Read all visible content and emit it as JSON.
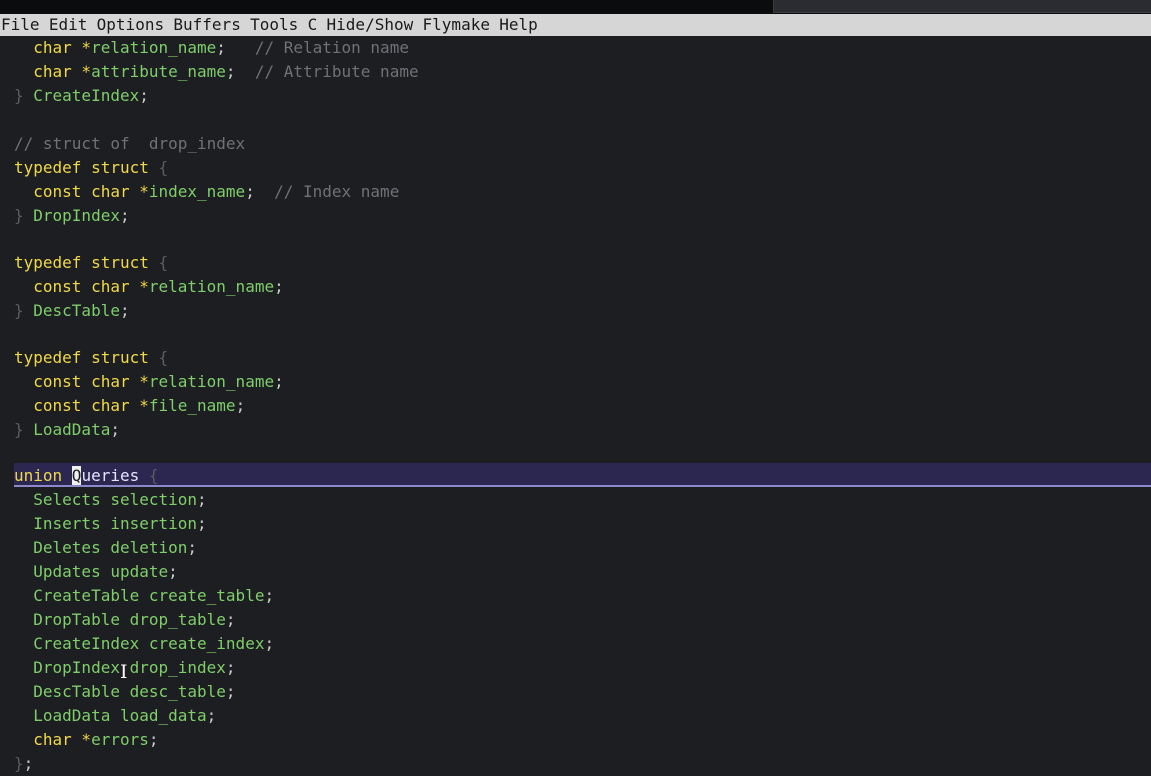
{
  "menubar": {
    "items": [
      "File",
      "Edit",
      "Options",
      "Buffers",
      "Tools",
      "C",
      "Hide/Show",
      "Flymake",
      "Help"
    ]
  },
  "editor": {
    "lines": [
      {
        "t1": "  char *",
        "t2": "relation_name",
        "t3": ";   ",
        "t4": "// Relation name"
      },
      {
        "t1": "  char *",
        "t2": "attribute_name",
        "t3": ";  ",
        "t4": "// Attribute name"
      },
      {
        "t1": "} ",
        "t2": "CreateIndex",
        "t3": ";"
      },
      {
        "t1": ""
      },
      {
        "t1": "// struct of  drop_index"
      },
      {
        "t1": "typedef struct ",
        "t2": "{"
      },
      {
        "t1": "  const char *",
        "t2": "index_name",
        "t3": ";  ",
        "t4": "// Index name"
      },
      {
        "t1": "} ",
        "t2": "DropIndex",
        "t3": ";"
      },
      {
        "t1": ""
      },
      {
        "t1": "typedef struct ",
        "t2": "{"
      },
      {
        "t1": "  const char *",
        "t2": "relation_name",
        "t3": ";"
      },
      {
        "t1": "} ",
        "t2": "DescTable",
        "t3": ";"
      },
      {
        "t1": ""
      },
      {
        "t1": "typedef struct ",
        "t2": "{"
      },
      {
        "t1": "  const char *",
        "t2": "relation_name",
        "t3": ";"
      },
      {
        "t1": "  const char *",
        "t2": "file_name",
        "t3": ";"
      },
      {
        "t1": "} ",
        "t2": "LoadData",
        "t3": ";"
      },
      {
        "t1": ""
      },
      {
        "t1": "union ",
        "t2": "Q",
        "t3": "ueries ",
        "t4": "{"
      },
      {
        "t1": "  Selects ",
        "t2": "selection",
        "t3": ";"
      },
      {
        "t1": "  Inserts ",
        "t2": "insertion",
        "t3": ";"
      },
      {
        "t1": "  Deletes ",
        "t2": "deletion",
        "t3": ";"
      },
      {
        "t1": "  Updates ",
        "t2": "update",
        "t3": ";"
      },
      {
        "t1": "  CreateTable ",
        "t2": "create_table",
        "t3": ";"
      },
      {
        "t1": "  DropTable ",
        "t2": "drop_table",
        "t3": ";"
      },
      {
        "t1": "  CreateIndex ",
        "t2": "create_index",
        "t3": ";"
      },
      {
        "t1": "  DropIndex ",
        "t2": "drop_index",
        "t3": ";"
      },
      {
        "t1": "  DescTable ",
        "t2": "desc_table",
        "t3": ";"
      },
      {
        "t1": "  LoadData ",
        "t2": "load_data",
        "t3": ";"
      },
      {
        "t1": "  char *",
        "t2": "errors",
        "t3": ";"
      },
      {
        "t1": "}",
        "t2": ";"
      }
    ]
  },
  "colors": {
    "background": "#1d1e22",
    "keyword": "#f0d94a",
    "variable": "#7fce6a",
    "comment": "#6f7179",
    "current_line": "#2b2750"
  },
  "icons": {
    "mouse_cursor": "ibeam-icon"
  }
}
